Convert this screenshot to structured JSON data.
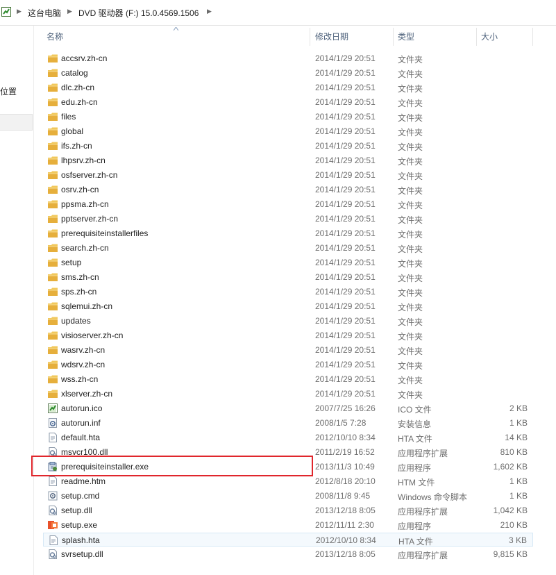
{
  "address": {
    "icon": "computer-icon",
    "crumbs": [
      "这台电脑",
      "DVD 驱动器 (F:) 15.0.4569.1506"
    ]
  },
  "nav": {
    "visible_label": "位置"
  },
  "columns": {
    "name": "名称",
    "date": "修改日期",
    "type": "类型",
    "size": "大小"
  },
  "files": [
    {
      "name": "accsrv.zh-cn",
      "date": "2014/1/29 20:51",
      "type": "文件夹",
      "size": "",
      "icon": "folder-icon"
    },
    {
      "name": "catalog",
      "date": "2014/1/29 20:51",
      "type": "文件夹",
      "size": "",
      "icon": "folder-icon"
    },
    {
      "name": "dlc.zh-cn",
      "date": "2014/1/29 20:51",
      "type": "文件夹",
      "size": "",
      "icon": "folder-icon"
    },
    {
      "name": "edu.zh-cn",
      "date": "2014/1/29 20:51",
      "type": "文件夹",
      "size": "",
      "icon": "folder-icon"
    },
    {
      "name": "files",
      "date": "2014/1/29 20:51",
      "type": "文件夹",
      "size": "",
      "icon": "folder-icon"
    },
    {
      "name": "global",
      "date": "2014/1/29 20:51",
      "type": "文件夹",
      "size": "",
      "icon": "folder-icon"
    },
    {
      "name": "ifs.zh-cn",
      "date": "2014/1/29 20:51",
      "type": "文件夹",
      "size": "",
      "icon": "folder-icon"
    },
    {
      "name": "lhpsrv.zh-cn",
      "date": "2014/1/29 20:51",
      "type": "文件夹",
      "size": "",
      "icon": "folder-icon"
    },
    {
      "name": "osfserver.zh-cn",
      "date": "2014/1/29 20:51",
      "type": "文件夹",
      "size": "",
      "icon": "folder-icon"
    },
    {
      "name": "osrv.zh-cn",
      "date": "2014/1/29 20:51",
      "type": "文件夹",
      "size": "",
      "icon": "folder-icon"
    },
    {
      "name": "ppsma.zh-cn",
      "date": "2014/1/29 20:51",
      "type": "文件夹",
      "size": "",
      "icon": "folder-icon"
    },
    {
      "name": "pptserver.zh-cn",
      "date": "2014/1/29 20:51",
      "type": "文件夹",
      "size": "",
      "icon": "folder-icon"
    },
    {
      "name": "prerequisiteinstallerfiles",
      "date": "2014/1/29 20:51",
      "type": "文件夹",
      "size": "",
      "icon": "folder-icon"
    },
    {
      "name": "search.zh-cn",
      "date": "2014/1/29 20:51",
      "type": "文件夹",
      "size": "",
      "icon": "folder-icon"
    },
    {
      "name": "setup",
      "date": "2014/1/29 20:51",
      "type": "文件夹",
      "size": "",
      "icon": "folder-icon"
    },
    {
      "name": "sms.zh-cn",
      "date": "2014/1/29 20:51",
      "type": "文件夹",
      "size": "",
      "icon": "folder-icon"
    },
    {
      "name": "sps.zh-cn",
      "date": "2014/1/29 20:51",
      "type": "文件夹",
      "size": "",
      "icon": "folder-icon"
    },
    {
      "name": "sqlemui.zh-cn",
      "date": "2014/1/29 20:51",
      "type": "文件夹",
      "size": "",
      "icon": "folder-icon"
    },
    {
      "name": "updates",
      "date": "2014/1/29 20:51",
      "type": "文件夹",
      "size": "",
      "icon": "folder-icon"
    },
    {
      "name": "visioserver.zh-cn",
      "date": "2014/1/29 20:51",
      "type": "文件夹",
      "size": "",
      "icon": "folder-icon"
    },
    {
      "name": "wasrv.zh-cn",
      "date": "2014/1/29 20:51",
      "type": "文件夹",
      "size": "",
      "icon": "folder-icon"
    },
    {
      "name": "wdsrv.zh-cn",
      "date": "2014/1/29 20:51",
      "type": "文件夹",
      "size": "",
      "icon": "folder-icon"
    },
    {
      "name": "wss.zh-cn",
      "date": "2014/1/29 20:51",
      "type": "文件夹",
      "size": "",
      "icon": "folder-icon"
    },
    {
      "name": "xlserver.zh-cn",
      "date": "2014/1/29 20:51",
      "type": "文件夹",
      "size": "",
      "icon": "folder-icon"
    },
    {
      "name": "autorun.ico",
      "date": "2007/7/25 16:26",
      "type": "ICO 文件",
      "size": "2 KB",
      "icon": "image-file-icon"
    },
    {
      "name": "autorun.inf",
      "date": "2008/1/5 7:28",
      "type": "安装信息",
      "size": "1 KB",
      "icon": "settings-file-icon"
    },
    {
      "name": "default.hta",
      "date": "2012/10/10 8:34",
      "type": "HTA 文件",
      "size": "14 KB",
      "icon": "document-file-icon"
    },
    {
      "name": "msvcr100.dll",
      "date": "2011/2/19 16:52",
      "type": "应用程序扩展",
      "size": "810 KB",
      "icon": "dll-file-icon"
    },
    {
      "name": "prerequisiteinstaller.exe",
      "date": "2013/11/3 10:49",
      "type": "应用程序",
      "size": "1,602 KB",
      "icon": "installer-exe-icon"
    },
    {
      "name": "readme.htm",
      "date": "2012/8/18 20:10",
      "type": "HTM 文件",
      "size": "1 KB",
      "icon": "document-file-icon"
    },
    {
      "name": "setup.cmd",
      "date": "2008/11/8 9:45",
      "type": "Windows 命令脚本",
      "size": "1 KB",
      "icon": "script-file-icon"
    },
    {
      "name": "setup.dll",
      "date": "2013/12/18 8:05",
      "type": "应用程序扩展",
      "size": "1,042 KB",
      "icon": "dll-file-icon"
    },
    {
      "name": "setup.exe",
      "date": "2012/11/11 2:30",
      "type": "应用程序",
      "size": "210 KB",
      "icon": "office-exe-icon"
    },
    {
      "name": "splash.hta",
      "date": "2012/10/10 8:34",
      "type": "HTA 文件",
      "size": "3 KB",
      "icon": "document-file-icon"
    },
    {
      "name": "svrsetup.dll",
      "date": "2013/12/18 8:05",
      "type": "应用程序扩展",
      "size": "9,815 KB",
      "icon": "dll-file-icon"
    }
  ],
  "selected_file": "splash.hta",
  "highlighted_file": "prerequisiteinstaller.exe",
  "colors": {
    "folder": "#e8b84a",
    "highlight_box": "#e0262c",
    "selection": "#d6e8f6",
    "header_text": "#4c607a"
  }
}
